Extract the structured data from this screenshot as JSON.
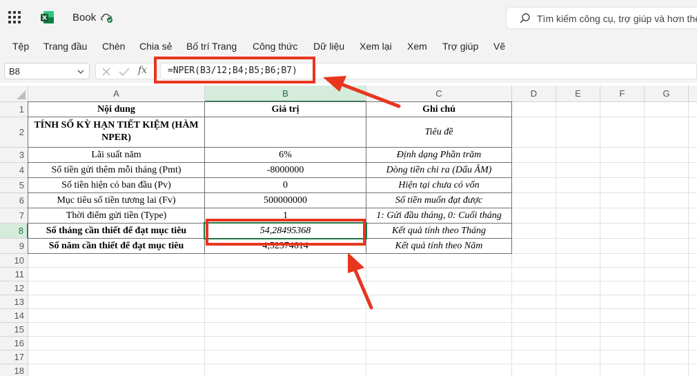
{
  "app": {
    "title": "Book",
    "search_placeholder": "Tìm kiếm công cụ, trợ giúp và hơn thế",
    "accent": "#217346",
    "annotation_color": "#e8361f"
  },
  "ribbon": {
    "tabs": [
      "Tệp",
      "Trang đầu",
      "Chèn",
      "Chia sẻ",
      "Bố trí Trang",
      "Công thức",
      "Dữ liệu",
      "Xem lại",
      "Xem",
      "Trợ giúp",
      "Vẽ"
    ]
  },
  "formula_bar": {
    "name_box": "B8",
    "formula": "=NPER(B3/12;B4;B5;B6;B7)",
    "fx_label": "fx"
  },
  "sheet": {
    "columns": [
      "A",
      "B",
      "C",
      "D",
      "E",
      "F",
      "G"
    ],
    "rows": [
      "1",
      "2",
      "3",
      "4",
      "5",
      "6",
      "7",
      "8",
      "9",
      "10",
      "11",
      "12",
      "13",
      "14",
      "15",
      "16",
      "17",
      "18"
    ],
    "active_cell": "B8",
    "cells": {
      "A1": "Nội dung",
      "B1": "Giá trị",
      "C1": "Ghi chú",
      "A2": "TÍNH SỐ KỲ HẠN TIẾT KIỆM (HÀM NPER)",
      "B2": "",
      "C2": "Tiêu đề",
      "A3": "Lãi suất năm",
      "B3": "6%",
      "C3": "Định dạng Phần trăm",
      "A4": "Số tiền gửi thêm mỗi tháng (Pmt)",
      "B4": "-8000000",
      "C4": "Dòng tiền chi ra (Dấu ÂM)",
      "A5": "Số tiền hiện có ban đầu (Pv)",
      "B5": "0",
      "C5": "Hiện tại chưa có vốn",
      "A6": "Mục tiêu số tiền tương lai (Fv)",
      "B6": "500000000",
      "C6": "Số tiền muốn đạt được",
      "A7": "Thời điểm gửi tiền (Type)",
      "B7": "1",
      "C7": "1: Gửi đầu tháng, 0: Cuối tháng",
      "A8": "Số tháng cần thiết để đạt mục tiêu",
      "B8": "54,28495368",
      "C8": "Kết quả tính theo Tháng",
      "A9": "Số năm cần thiết để đạt mục tiêu",
      "B9": "4,52374614",
      "C9": "Kết quả tính theo Năm"
    }
  }
}
